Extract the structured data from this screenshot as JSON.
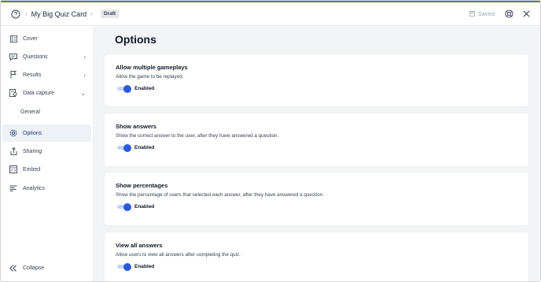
{
  "header": {
    "title": "My Big Quiz Card",
    "badge": "Draft",
    "saved": "Saved"
  },
  "sidebar": {
    "items": [
      {
        "label": "Cover",
        "icon": "cover-icon"
      },
      {
        "label": "Questions",
        "icon": "questions-icon",
        "arrow": "›"
      },
      {
        "label": "Results",
        "icon": "results-icon",
        "arrow": "›"
      },
      {
        "label": "Data capture",
        "icon": "data-capture-icon",
        "arrow": "⌄"
      },
      {
        "label": "General"
      },
      {
        "label": "Options",
        "icon": "options-icon"
      },
      {
        "label": "Sharing",
        "icon": "sharing-icon"
      },
      {
        "label": "Embed",
        "icon": "embed-icon"
      },
      {
        "label": "Analytics",
        "icon": "analytics-icon"
      }
    ],
    "collapse_label": "Collapse"
  },
  "main": {
    "title": "Options",
    "cards": [
      {
        "title": "Allow multiple gameplays",
        "description": "Allow the game to be replayed.",
        "toggle": "Enabled"
      },
      {
        "title": "Show answers",
        "description": "Show the correct answer to the user, after they have answered a question.",
        "toggle": "Enabled"
      },
      {
        "title": "Show percentages",
        "description": "Show the percentage of users that selected each answer, after they have answered a question.",
        "toggle": "Enabled"
      },
      {
        "title": "View all answers",
        "description": "Allow users to view all answers after completing the quiz.",
        "toggle": "Enabled"
      }
    ]
  },
  "colors": {
    "accent": "#2a5bd7",
    "active_bg": "#eef2f7",
    "main_bg": "#f3f4f6"
  }
}
